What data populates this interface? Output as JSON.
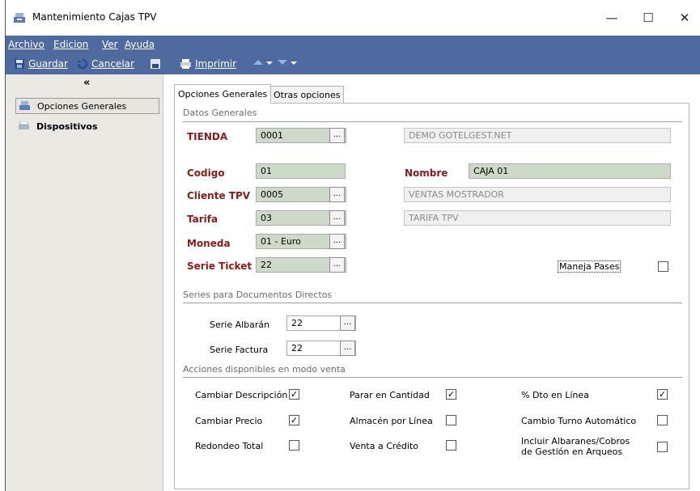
{
  "window": {
    "title": "Mantenimiento Cajas TPV",
    "minimize": "—",
    "maximize": "☐",
    "close": "✕"
  },
  "menu": [
    "Archivo",
    "Edicion",
    "Ver",
    "Ayuda"
  ],
  "toolbar": {
    "save": "Guardar",
    "cancel": "Cancelar",
    "print": "Imprimir"
  },
  "sidebar": {
    "collapse": "«",
    "items": [
      "Opciones Generales",
      "Dispositivos"
    ]
  },
  "tabs": [
    "Opciones Generales",
    "Otras opciones"
  ],
  "datos_generales": {
    "section": "Datos Generales",
    "tienda": {
      "label": "TIENDA",
      "code": "0001",
      "desc": "DEMO GOTELGEST.NET"
    },
    "codigo": {
      "label": "Codigo",
      "value": "01"
    },
    "nombre": {
      "label": "Nombre",
      "value": "CAJA 01"
    },
    "cliente": {
      "label": "Cliente TPV",
      "code": "0005",
      "desc": "VENTAS MOSTRADOR"
    },
    "tarifa": {
      "label": "Tarifa",
      "code": "03",
      "desc": "TARIFA TPV"
    },
    "moneda": {
      "label": "Moneda",
      "value": "01 - Euro"
    },
    "serie_ticket": {
      "label": "Serie Ticket",
      "value": "22"
    },
    "maneja_pases": {
      "label": "Maneja Pases"
    },
    "dots": "..."
  },
  "series": {
    "section": "Series para Documentos Directos",
    "albaran": {
      "label": "Serie Albarán",
      "value": "22"
    },
    "factura": {
      "label": "Serie Factura",
      "value": "22"
    }
  },
  "acciones": {
    "section": "Acciones disponibles en modo venta",
    "items": [
      {
        "label": "Cambiar Descripción",
        "checked": "✓"
      },
      {
        "label": "Parar en Cantidad",
        "checked": "✓"
      },
      {
        "label": "% Dto en Línea",
        "checked": "✓"
      },
      {
        "label": "Cambiar Precio",
        "checked": "✓"
      },
      {
        "label": "Almacén por Línea",
        "checked": ""
      },
      {
        "label": "Cambio Turno Automático",
        "checked": ""
      },
      {
        "label": "Redondeo Total",
        "checked": ""
      },
      {
        "label": "Venta a Crédito",
        "checked": ""
      },
      {
        "label": "Incluir Albaranes/Cobros de Gestión en Arqueos",
        "checked": ""
      }
    ]
  }
}
